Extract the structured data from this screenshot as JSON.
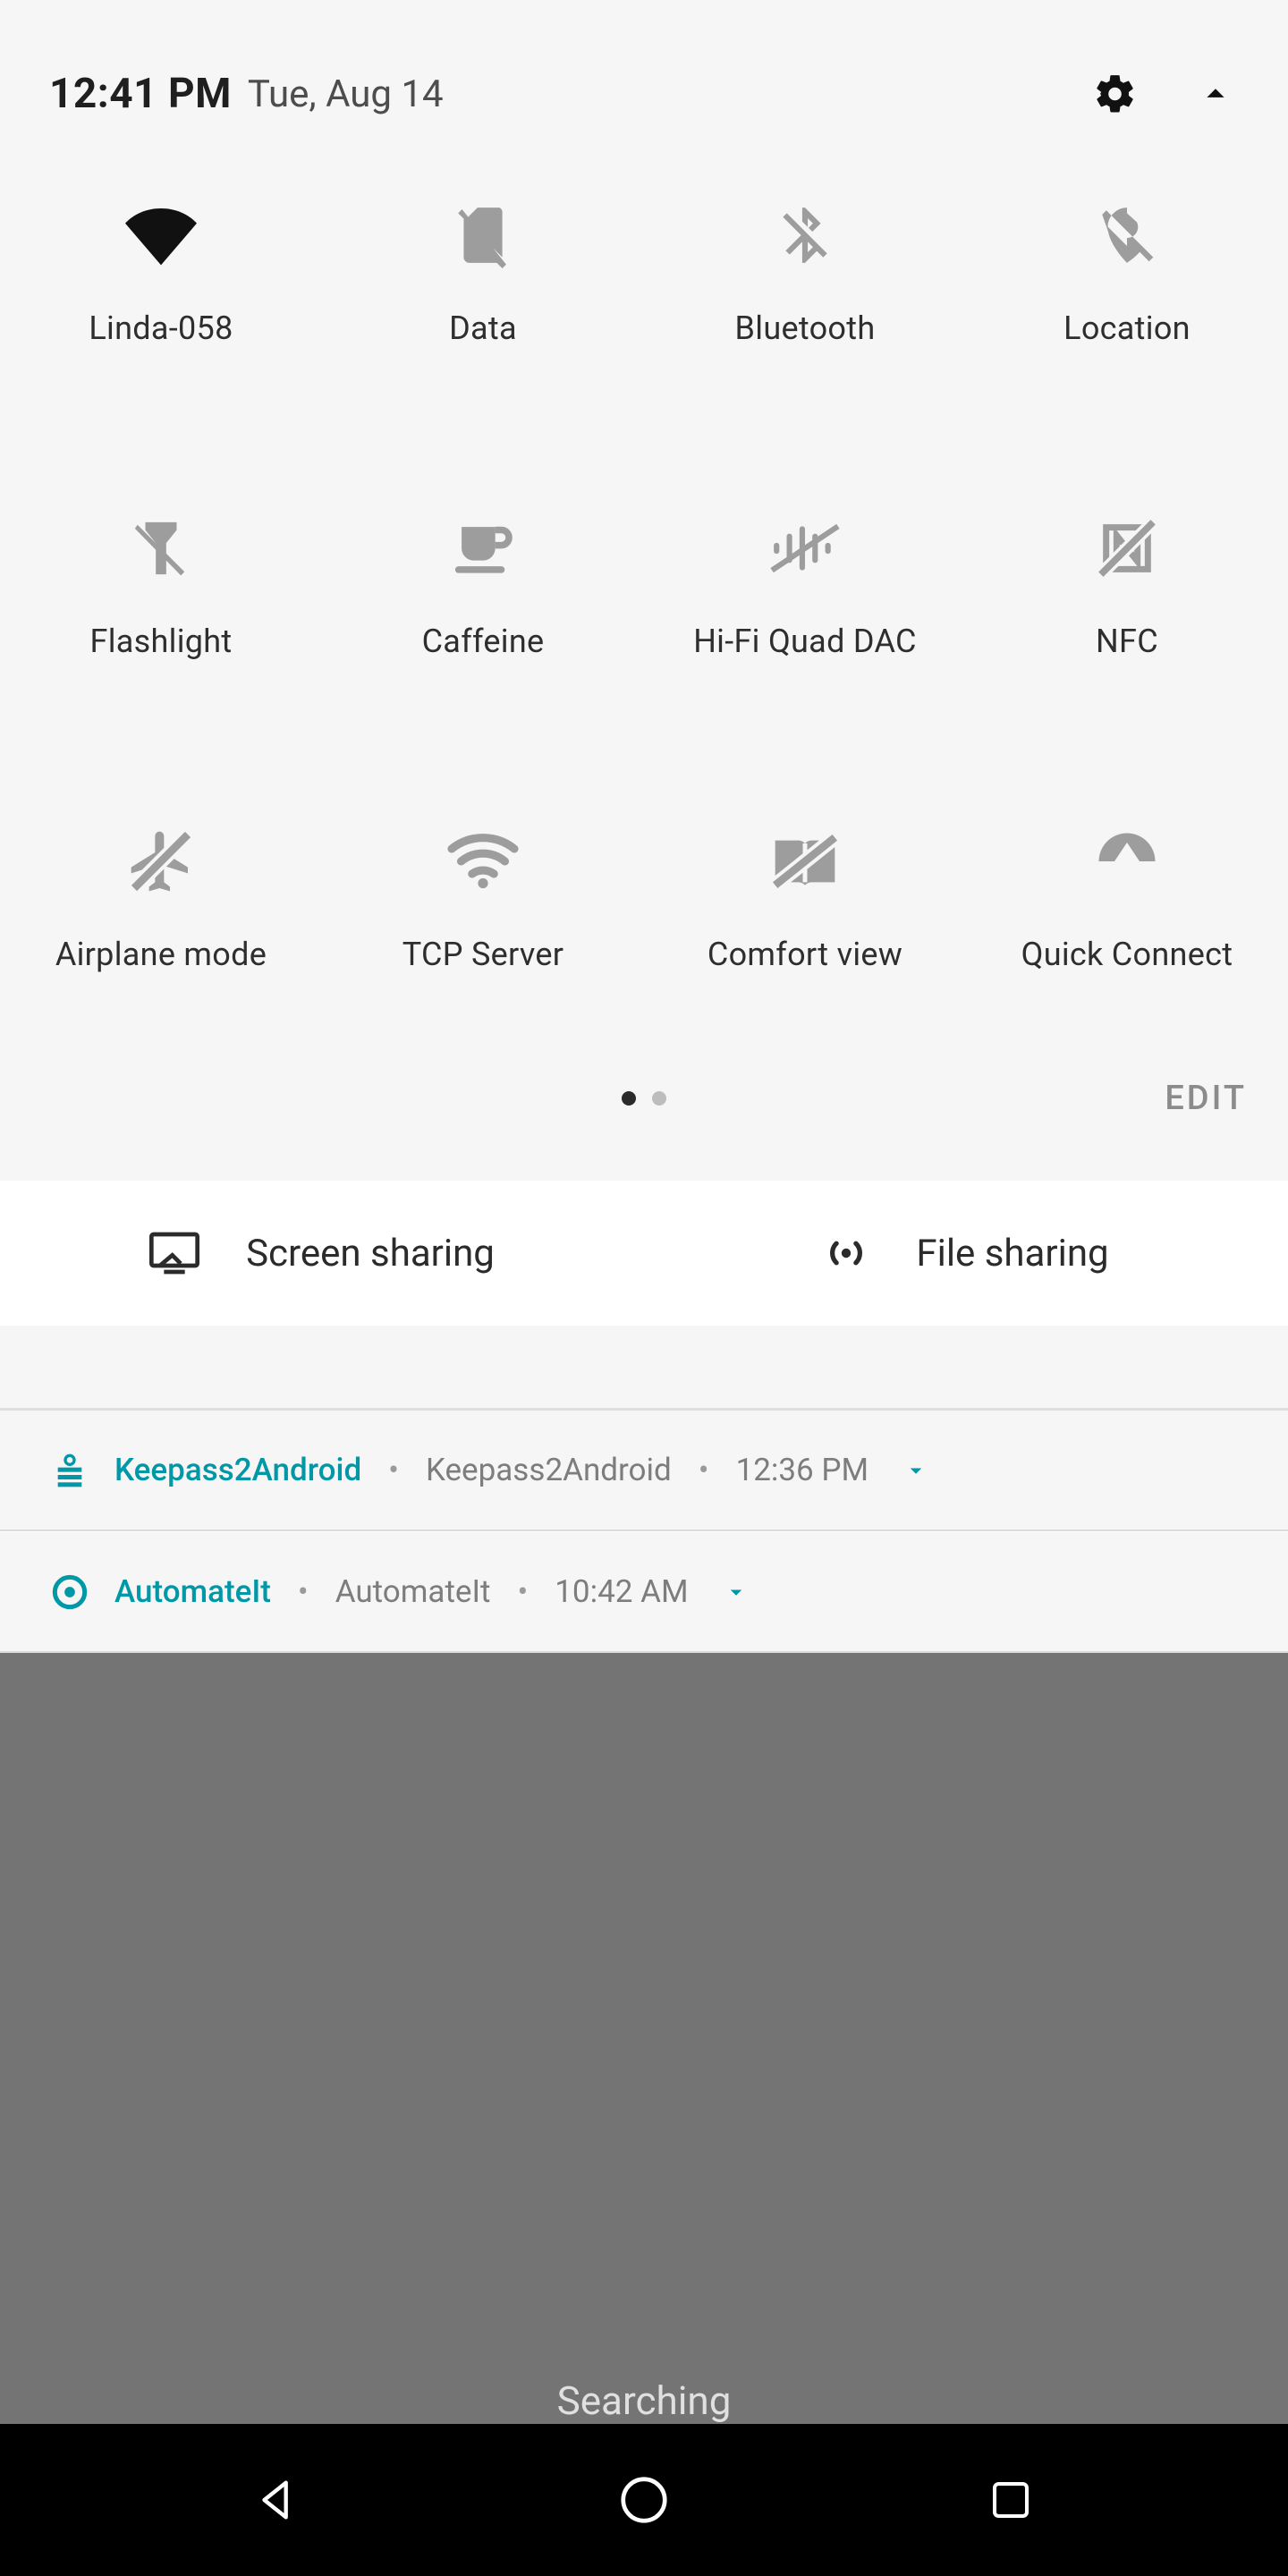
{
  "header": {
    "time": "12:41 PM",
    "date": "Tue, Aug 14"
  },
  "tiles": [
    {
      "label": "Linda-058"
    },
    {
      "label": "Data"
    },
    {
      "label": "Bluetooth"
    },
    {
      "label": "Location"
    },
    {
      "label": "Flashlight"
    },
    {
      "label": "Caffeine"
    },
    {
      "label": "Hi-Fi Quad DAC"
    },
    {
      "label": "NFC"
    },
    {
      "label": "Airplane mode"
    },
    {
      "label": "TCP Server"
    },
    {
      "label": "Comfort view"
    },
    {
      "label": "Quick Connect"
    }
  ],
  "edit_label": "EDIT",
  "share": {
    "screen": "Screen sharing",
    "file": "File sharing"
  },
  "notifications": [
    {
      "app": "Keepass2Android",
      "title": "Keepass2Android",
      "time": "12:36 PM"
    },
    {
      "app": "AutomateIt",
      "title": "AutomateIt",
      "time": "10:42 AM"
    }
  ],
  "status_text": "Searching",
  "colors": {
    "accent": "#0097a7",
    "icon_on": "#111111",
    "icon_off": "#9d9d9d",
    "panel_bg": "#f6f6f6"
  }
}
